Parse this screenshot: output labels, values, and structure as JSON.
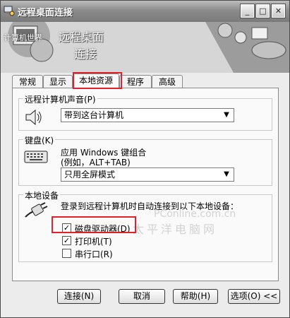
{
  "window": {
    "title": "远程桌面连接"
  },
  "titlebar_buttons": {
    "minimize": "_",
    "maximize": "□",
    "close": "✕"
  },
  "banner": {
    "line1": "远程桌面",
    "line2": "连接",
    "watermark_left": "计算机世界"
  },
  "tabs": [
    "常规",
    "显示",
    "本地资源",
    "程序",
    "高级"
  ],
  "active_tab": "本地资源",
  "sound": {
    "group_label": "远程计算机声音(P)",
    "selected": "带到这台计算机"
  },
  "keyboard": {
    "group_label": "键盘(K)",
    "desc_line1": "应用 Windows 键组合",
    "desc_line2": "(例如，ALT+TAB)",
    "selected": "只用全屏模式"
  },
  "devices": {
    "group_label": "本地设备",
    "desc": "登录到远程计算机时自动连接到以下本地设备：",
    "items": [
      {
        "label": "磁盘驱动器(D)",
        "checked": true
      },
      {
        "label": "打印机(T)",
        "checked": true
      },
      {
        "label": "串行口(R)",
        "checked": false
      }
    ]
  },
  "watermark": {
    "brand": "PConline.com.cn",
    "cn": "太平洋电脑网"
  },
  "buttons": {
    "connect": "连接(N)",
    "cancel": "取消",
    "help": "帮助(H)",
    "options": "选项(O) <<"
  },
  "colors": {
    "highlight": "#e0202a"
  }
}
